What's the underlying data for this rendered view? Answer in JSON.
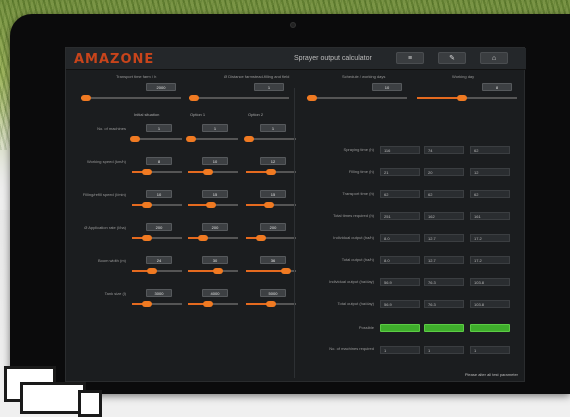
{
  "app": {
    "logo": "AMAZONE",
    "title": "Sprayer output calculator",
    "nav": [
      {
        "name": "menu",
        "glyph": "≡"
      },
      {
        "name": "edit",
        "glyph": "✎"
      },
      {
        "name": "home",
        "glyph": "⌂"
      }
    ],
    "accent": "#e56a1f",
    "good": "#3fae2c"
  },
  "top_params": [
    {
      "label": "Transport time farm / h",
      "value": "2000",
      "fill": 0.05
    },
    {
      "label": "Ø Distance farmstead-filling and field",
      "value": "1",
      "fill": 0.05
    },
    {
      "label": "Schedule / working days",
      "value": "10",
      "fill": 0.05
    },
    {
      "label": "Working day",
      "value": "8",
      "fill": 0.45
    }
  ],
  "columns": [
    "Initial situation",
    "Option 1",
    "Option 2"
  ],
  "left_rows": [
    {
      "label": "No. of machines",
      "values": [
        "1",
        "1",
        "1"
      ],
      "fills": [
        0.05,
        0.05,
        0.05
      ]
    },
    {
      "label": "Working speed (km/h)",
      "values": [
        "8",
        "10",
        "12"
      ],
      "fills": [
        0.3,
        0.4,
        0.5
      ]
    },
    {
      "label": "Filling/refill speed (l/min)",
      "values": [
        "10",
        "15",
        "15"
      ],
      "fills": [
        0.3,
        0.45,
        0.45
      ]
    },
    {
      "label": "Ø Application rate (l/ha)",
      "values": [
        "200",
        "200",
        "200"
      ],
      "fills": [
        0.3,
        0.3,
        0.3
      ]
    },
    {
      "label": "Boom width (m)",
      "values": [
        "24",
        "30",
        "36"
      ],
      "fills": [
        0.4,
        0.6,
        0.8
      ]
    },
    {
      "label": "Tank size (l)",
      "values": [
        "3000",
        "4000",
        "5000"
      ],
      "fills": [
        0.3,
        0.4,
        0.5
      ]
    }
  ],
  "right_rows": [
    {
      "label": "Spraying time (h)",
      "values": [
        "116",
        "74",
        "62"
      ]
    },
    {
      "label": "Filling time (h)",
      "values": [
        "21",
        "20",
        "12"
      ]
    },
    {
      "label": "Transport time (h)",
      "values": [
        "62",
        "62",
        "62"
      ]
    },
    {
      "label": "Total times required (h)",
      "values": [
        "251",
        "162",
        "161"
      ]
    },
    {
      "label": "Individual output (ha/h)",
      "values": [
        "8.0",
        "12.7",
        "17.2"
      ]
    },
    {
      "label": "Total output (ha/h)",
      "values": [
        "8.0",
        "12.7",
        "17.2"
      ]
    },
    {
      "label": "Individual output (ha/day)",
      "values": [
        "56.9",
        "76.3",
        "103.8"
      ]
    },
    {
      "label": "Total output (ha/day)",
      "values": [
        "56.9",
        "76.3",
        "103.8"
      ]
    }
  ],
  "possible": {
    "label": "Possible"
  },
  "machines_required": {
    "label": "No. of machines required",
    "values": [
      "1",
      "1",
      "1"
    ]
  },
  "footer": "Please alter all test parameter"
}
